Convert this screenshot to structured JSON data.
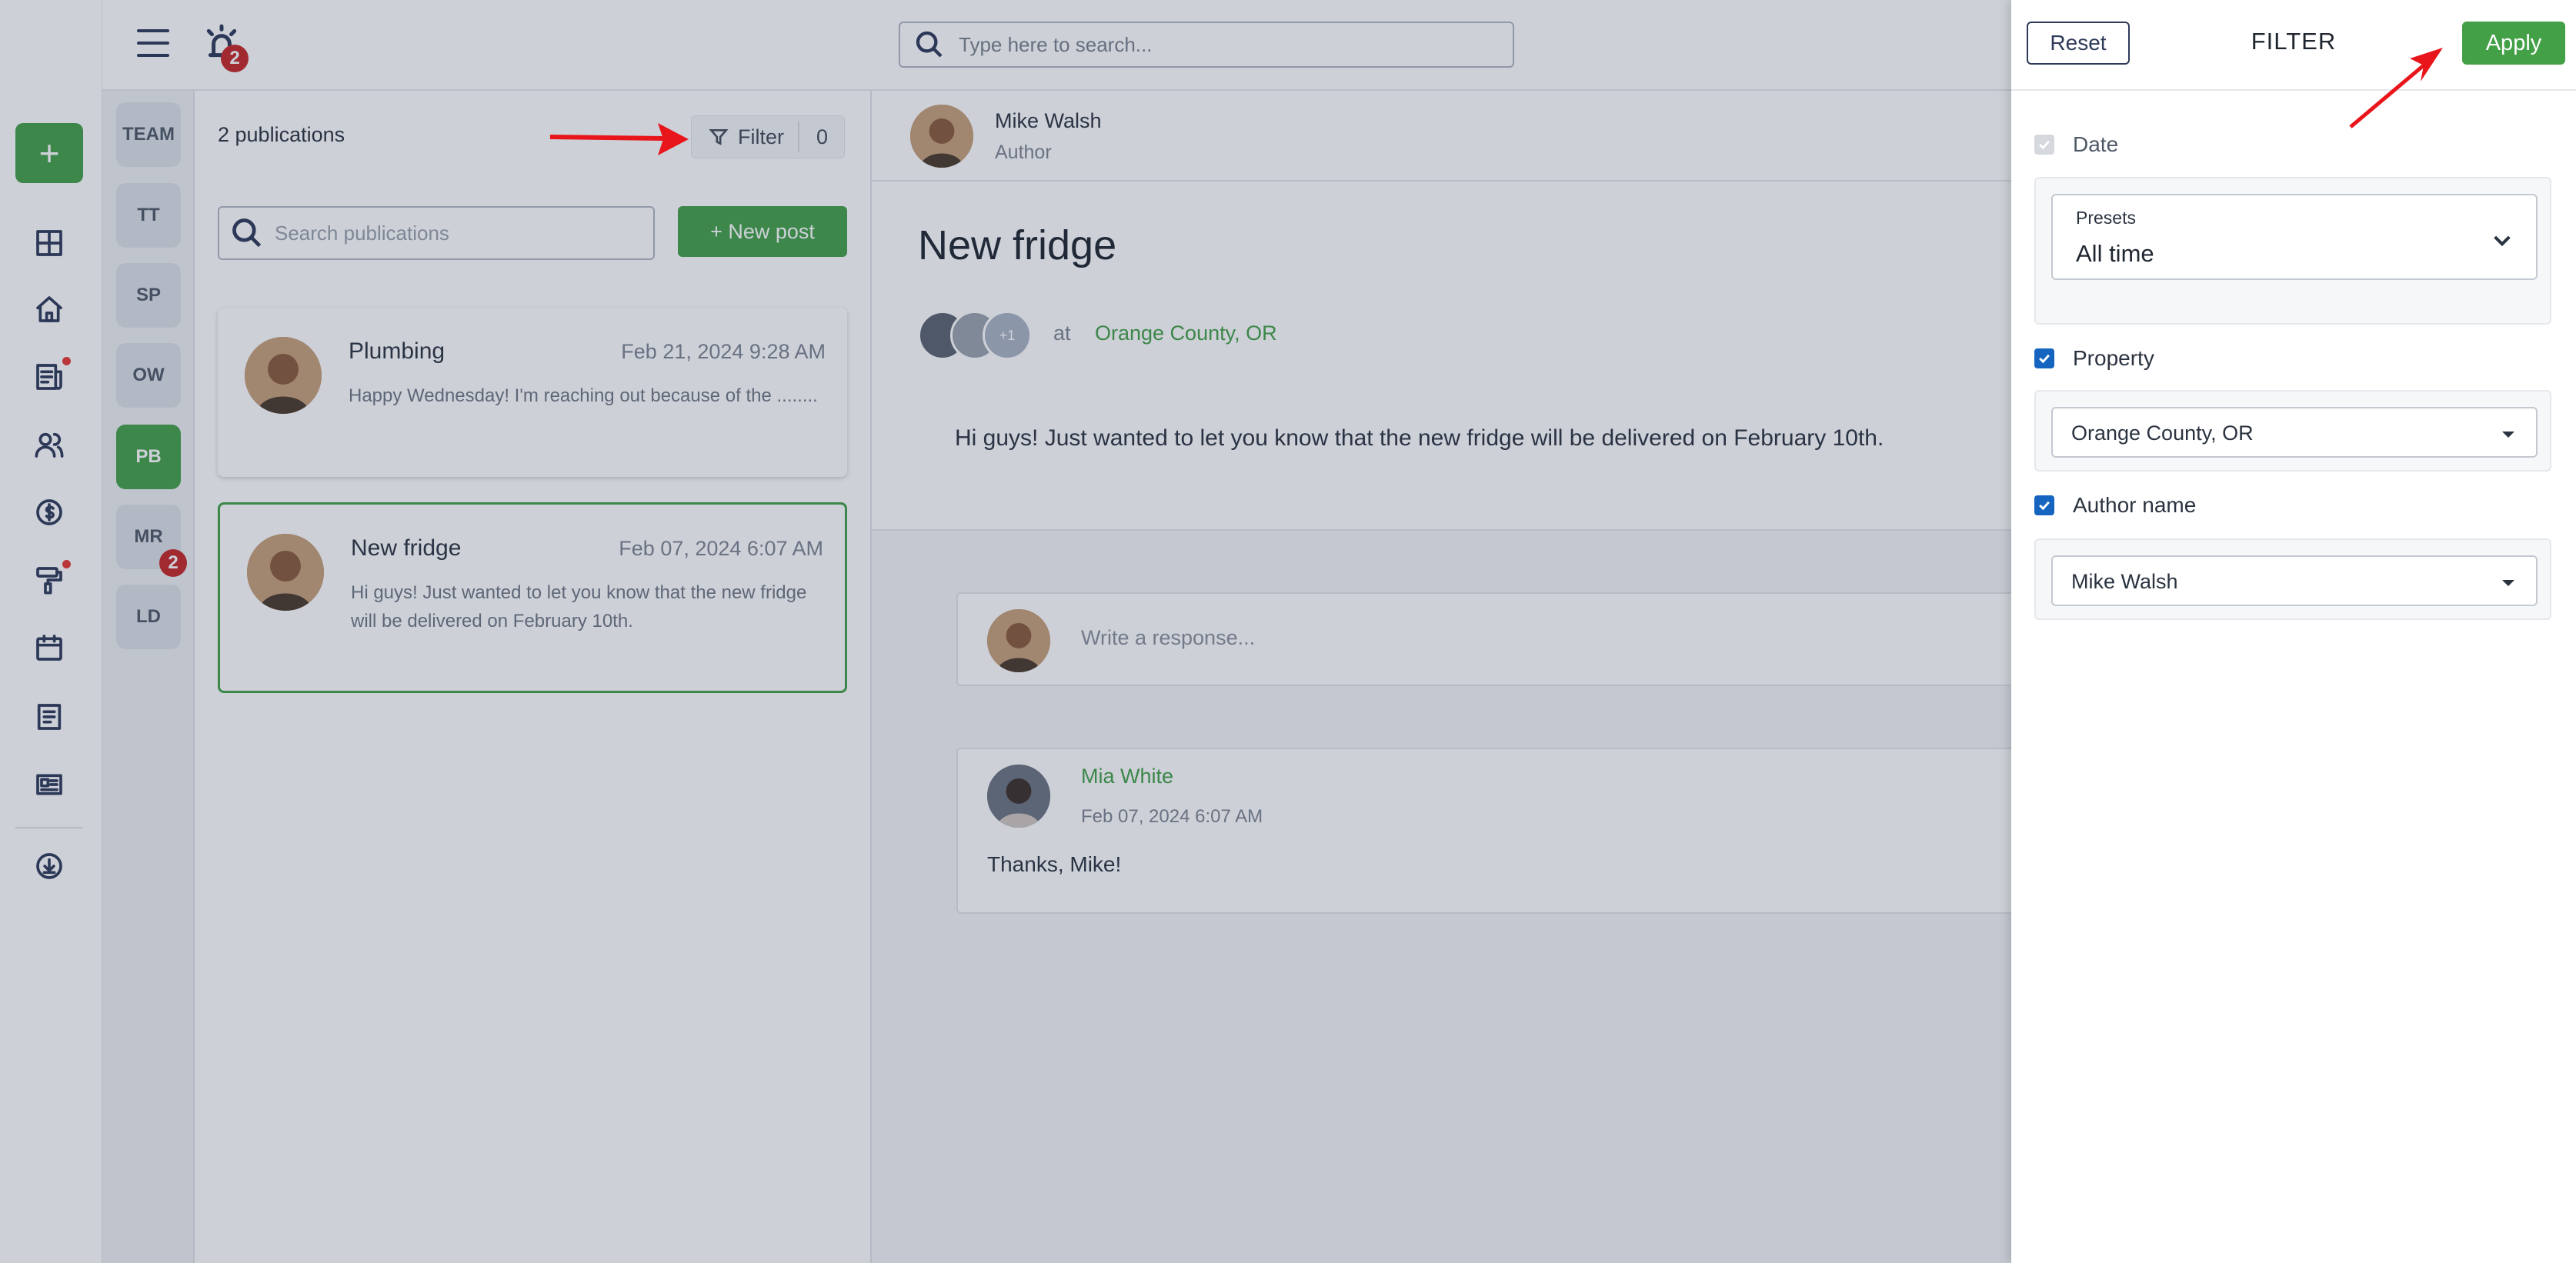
{
  "header": {
    "search_placeholder": "Type here to search...",
    "alarm_badge": "2"
  },
  "sidebar": {
    "add_label": "+",
    "icons": [
      "dashboard-icon",
      "home-icon",
      "news-icon",
      "users-icon",
      "dollar-icon",
      "paint-roller-icon",
      "calendar-icon",
      "document-icon",
      "newspaper-icon",
      "cloud-download-icon"
    ]
  },
  "rail": {
    "items": [
      {
        "label": "TEAM"
      },
      {
        "label": "TT"
      },
      {
        "label": "SP"
      },
      {
        "label": "OW"
      },
      {
        "label": "PB"
      },
      {
        "label": "MR",
        "badge": "2"
      },
      {
        "label": "LD"
      }
    ]
  },
  "publist": {
    "count": "2 publications",
    "filter_label": "Filter",
    "filter_count": "0",
    "search_placeholder": "Search publications",
    "new_post": "+ New post",
    "cards": [
      {
        "title": "Plumbing",
        "date": "Feb 21, 2024 9:28 AM",
        "snippet": "Happy Wednesday! I'm reaching out because of the ........"
      },
      {
        "title": "New fridge",
        "date": "Feb 07, 2024 6:07 AM",
        "snippet": "Hi guys! Just wanted to let you know that the new fridge will be delivered on February 10th."
      }
    ]
  },
  "post": {
    "author_name": "Mike Walsh",
    "author_role": "Author",
    "title": "New fridge",
    "recipients_more": "+1",
    "at": "at",
    "location": "Orange County, OR",
    "body": "Hi guys! Just wanted to let you know that the new fridge will be delivered on February 10th.",
    "response_placeholder": "Write a response...",
    "comment": {
      "name": "Mia White",
      "date": "Feb 07, 2024 6:07 AM",
      "text": "Thanks, Mike!"
    }
  },
  "filter_panel": {
    "reset": "Reset",
    "title": "FILTER",
    "apply": "Apply",
    "date_label": "Date",
    "presets_label": "Presets",
    "presets_value": "All time",
    "property_label": "Property",
    "property_value": "Orange County, OR",
    "author_label": "Author name",
    "author_value": "Mike Walsh"
  },
  "colors": {
    "accent_green": "#43a047",
    "badge_red": "#c62828",
    "checkbox_blue": "#1565c0",
    "annotation_red": "#e8151b"
  }
}
